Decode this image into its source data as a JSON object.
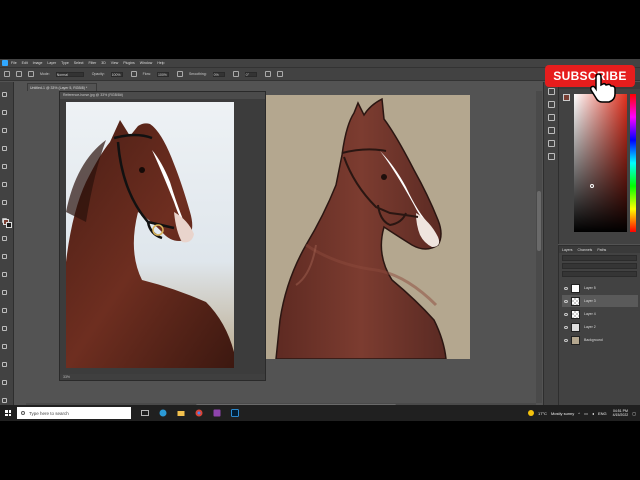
{
  "menubar": {
    "items": [
      "File",
      "Edit",
      "Image",
      "Layer",
      "Type",
      "Select",
      "Filter",
      "3D",
      "View",
      "Plugins",
      "Window",
      "Help"
    ]
  },
  "options": {
    "mode_label": "Mode:",
    "mode_value": "Normal",
    "opacity_label": "Opacity:",
    "opacity_value": "100%",
    "flow_label": "Flow:",
    "flow_value": "100%",
    "smoothing_label": "Smoothing:",
    "smoothing_value": "0%",
    "angle_value": "0°"
  },
  "document": {
    "tab_title": "Untitled-1 @ 33% (Layer 5, RGB/8) *",
    "float_title": "Reference-horse.jpg @ 33% (RGB/8#)",
    "float_status": "33%",
    "status_zoom": "33%"
  },
  "subscribe": {
    "label": "SUBSCRIBE"
  },
  "layers": {
    "tabs": [
      "Layers",
      "Channels",
      "Paths"
    ],
    "rows": [
      {
        "name": "Layer 5",
        "selected": false
      },
      {
        "name": "Layer 3",
        "selected": true
      },
      {
        "name": "Layer 4",
        "selected": false
      },
      {
        "name": "Layer 2",
        "selected": false
      },
      {
        "name": "Background",
        "selected": false
      }
    ]
  },
  "taskbar": {
    "search_placeholder": "Type here to search",
    "weather_temp": "17°C",
    "weather_text": "Mostly sunny",
    "language": "ENG",
    "time": "04:51 PM",
    "date": "4/15/2022"
  },
  "colors": {
    "foreground": "#7a3f33",
    "subscribe_red": "#e61d1d",
    "workspace": "#535353"
  }
}
